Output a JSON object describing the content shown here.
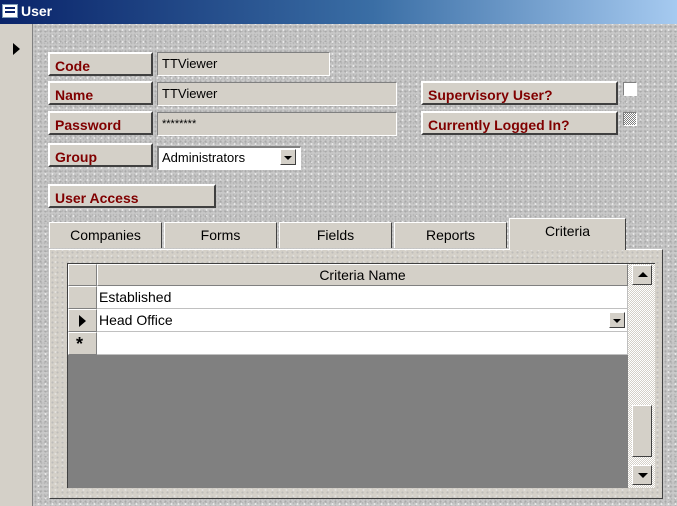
{
  "window": {
    "title": "User"
  },
  "form": {
    "code": {
      "label": "Code",
      "value": "TTViewer"
    },
    "name": {
      "label": "Name",
      "value": "TTViewer"
    },
    "password": {
      "label": "Password",
      "value": "********"
    },
    "group": {
      "label": "Group",
      "value": "Administrators"
    },
    "user_access_label": "User Access",
    "supervisory": {
      "label": "Supervisory User?",
      "checked": false
    },
    "logged_in": {
      "label": "Currently Logged In?",
      "state": "indeterminate"
    }
  },
  "tabs": [
    {
      "label": "Companies"
    },
    {
      "label": "Forms"
    },
    {
      "label": "Fields"
    },
    {
      "label": "Reports"
    },
    {
      "label": "Criteria",
      "active": true
    }
  ],
  "criteria_grid": {
    "column": "Criteria Name",
    "rows": [
      "Established",
      "Head Office"
    ],
    "new_row_marker": "*"
  },
  "icons": {
    "window": "form-icon",
    "record_selector": "current-record-arrow-icon",
    "new_record": "new-record-star-icon"
  }
}
